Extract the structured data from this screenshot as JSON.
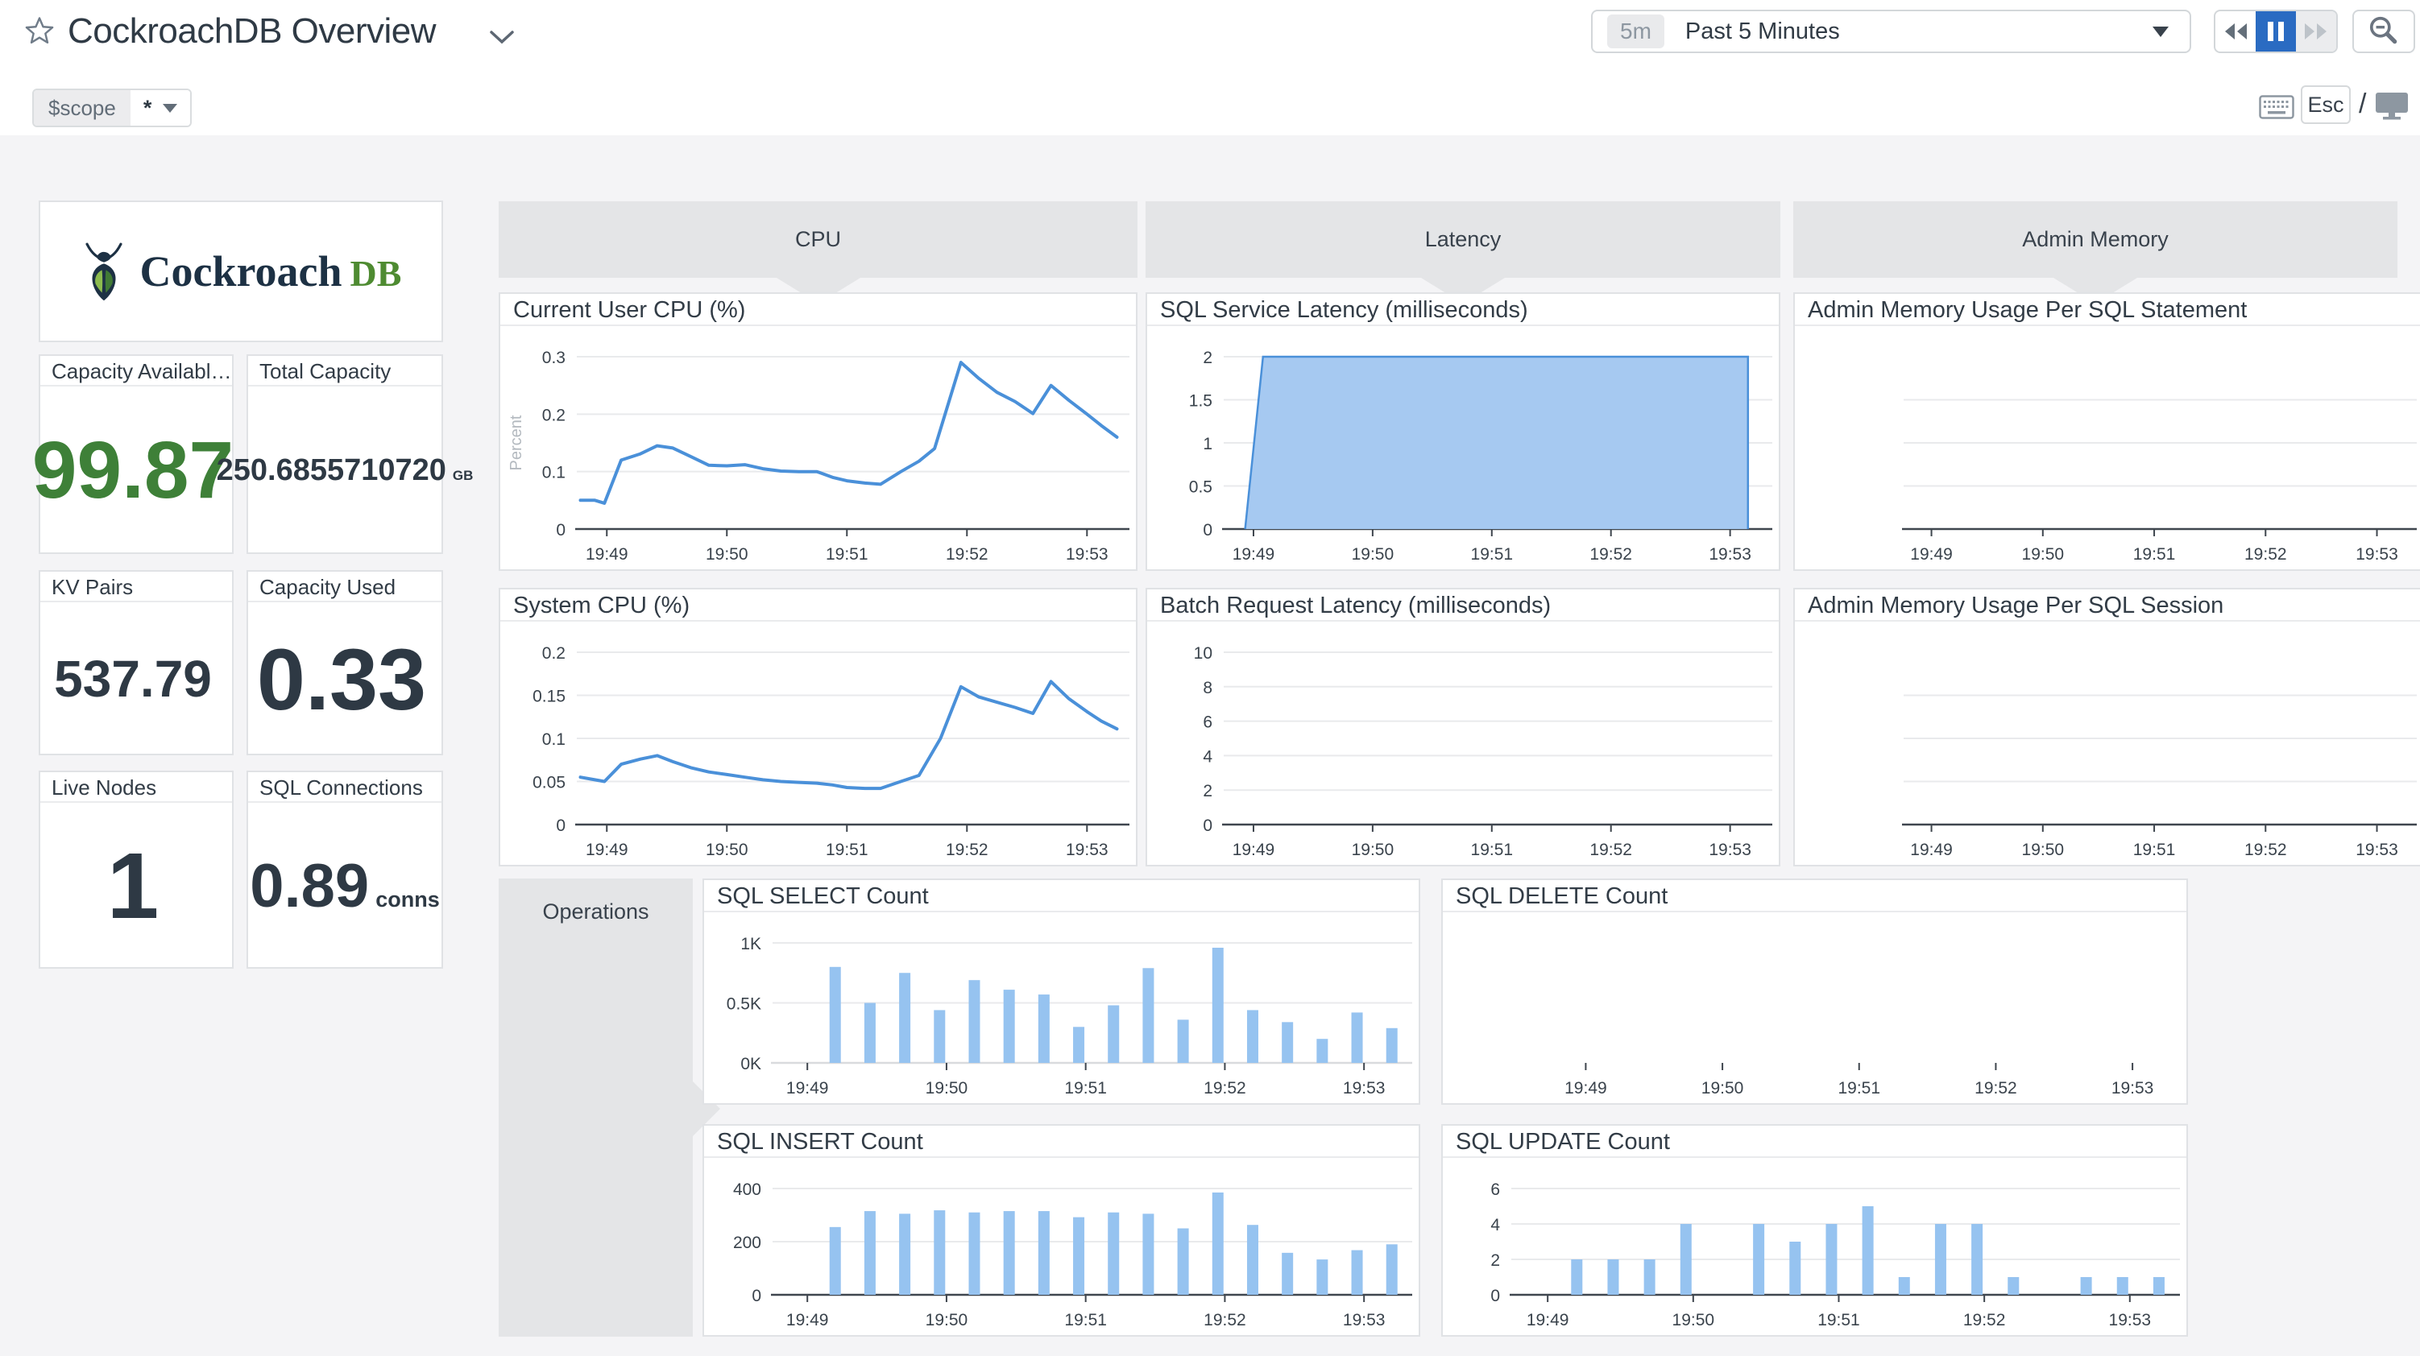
{
  "header": {
    "title": "CockroachDB Overview",
    "time_badge": "5m",
    "time_label": "Past 5 Minutes",
    "esc": "Esc",
    "slash": "/"
  },
  "scope": {
    "label": "$scope",
    "value": "*"
  },
  "logo": {
    "brand": "Cockroach",
    "brand_suffix": "DB"
  },
  "groups": {
    "cpu": "CPU",
    "latency": "Latency",
    "admin_memory": "Admin Memory",
    "operations": "Operations"
  },
  "stats": [
    {
      "label": "Capacity Available...",
      "value": "99.87",
      "unit": "",
      "color": "#3e8038"
    },
    {
      "label": "Total Capacity",
      "value": "250.6855710720",
      "unit": "GB",
      "color": "#2e3944"
    },
    {
      "label": "KV Pairs",
      "value": "537.79",
      "unit": "",
      "color": "#2e3944"
    },
    {
      "label": "Capacity Used",
      "value": "0.33",
      "unit": "",
      "color": "#2e3944"
    },
    {
      "label": "Live Nodes",
      "value": "1",
      "unit": "",
      "color": "#2e3944"
    },
    {
      "label": "SQL Connections",
      "value": "0.89",
      "unit": "conns",
      "color": "#2e3944"
    }
  ],
  "chart_x": {
    "domain": [
      48.75,
      53.3
    ],
    "tick_minutes": [
      49,
      50,
      51,
      52,
      53
    ],
    "tick_labels": [
      "19:49",
      "19:50",
      "19:51",
      "19:52",
      "19:53"
    ]
  },
  "chart_data": [
    {
      "id": "user_cpu",
      "type": "line",
      "title": "Current User CPU (%)",
      "ylabel": "Percent",
      "yticks": [
        0,
        0.1,
        0.2,
        0.3
      ],
      "ytick_labels": [
        "0",
        "0.1",
        "0.2",
        "0.3"
      ],
      "ymax": 0.3,
      "line_color": "#4a90d9",
      "grid": true,
      "legend": "none",
      "points": [
        [
          48.78,
          0.05
        ],
        [
          48.9,
          0.05
        ],
        [
          48.98,
          0.045
        ],
        [
          49.12,
          0.12
        ],
        [
          49.28,
          0.131
        ],
        [
          49.42,
          0.145
        ],
        [
          49.55,
          0.141
        ],
        [
          49.7,
          0.126
        ],
        [
          49.85,
          0.111
        ],
        [
          50.0,
          0.11
        ],
        [
          50.15,
          0.112
        ],
        [
          50.3,
          0.105
        ],
        [
          50.45,
          0.101
        ],
        [
          50.6,
          0.1
        ],
        [
          50.75,
          0.1
        ],
        [
          50.88,
          0.09
        ],
        [
          51.0,
          0.084
        ],
        [
          51.15,
          0.08
        ],
        [
          51.28,
          0.078
        ],
        [
          51.45,
          0.1
        ],
        [
          51.6,
          0.118
        ],
        [
          51.73,
          0.14
        ],
        [
          51.95,
          0.29
        ],
        [
          52.1,
          0.262
        ],
        [
          52.25,
          0.238
        ],
        [
          52.4,
          0.222
        ],
        [
          52.55,
          0.201
        ],
        [
          52.7,
          0.25
        ],
        [
          52.85,
          0.224
        ],
        [
          53.0,
          0.2
        ],
        [
          53.12,
          0.18
        ],
        [
          53.25,
          0.16
        ]
      ]
    },
    {
      "id": "system_cpu",
      "type": "line",
      "title": "System CPU (%)",
      "yticks": [
        0,
        0.05,
        0.1,
        0.15,
        0.2
      ],
      "ytick_labels": [
        "0",
        "0.05",
        "0.1",
        "0.15",
        "0.2"
      ],
      "ymax": 0.2,
      "line_color": "#4a90d9",
      "grid": true,
      "legend": "none",
      "points": [
        [
          48.78,
          0.055
        ],
        [
          48.9,
          0.052
        ],
        [
          48.98,
          0.05
        ],
        [
          49.12,
          0.07
        ],
        [
          49.28,
          0.076
        ],
        [
          49.42,
          0.08
        ],
        [
          49.55,
          0.073
        ],
        [
          49.7,
          0.066
        ],
        [
          49.85,
          0.061
        ],
        [
          50.0,
          0.058
        ],
        [
          50.15,
          0.055
        ],
        [
          50.3,
          0.052
        ],
        [
          50.45,
          0.05
        ],
        [
          50.6,
          0.049
        ],
        [
          50.75,
          0.048
        ],
        [
          50.88,
          0.046
        ],
        [
          51.0,
          0.043
        ],
        [
          51.15,
          0.042
        ],
        [
          51.28,
          0.042
        ],
        [
          51.45,
          0.05
        ],
        [
          51.6,
          0.057
        ],
        [
          51.78,
          0.1
        ],
        [
          51.95,
          0.16
        ],
        [
          52.1,
          0.148
        ],
        [
          52.25,
          0.142
        ],
        [
          52.4,
          0.136
        ],
        [
          52.55,
          0.129
        ],
        [
          52.7,
          0.166
        ],
        [
          52.85,
          0.146
        ],
        [
          53.0,
          0.131
        ],
        [
          53.12,
          0.12
        ],
        [
          53.25,
          0.111
        ]
      ]
    },
    {
      "id": "sql_service_latency",
      "type": "area",
      "title": "SQL Service Latency (milliseconds)",
      "yticks": [
        0,
        0.5,
        1,
        1.5,
        2
      ],
      "ytick_labels": [
        "0",
        "0.5",
        "1",
        "1.5",
        "2"
      ],
      "ymax": 2,
      "fill_color": "#a6c9f1",
      "line_color": "#4a90d9",
      "grid": true,
      "legend": "none",
      "points": [
        [
          48.93,
          0
        ],
        [
          49.08,
          2
        ],
        [
          53.15,
          2
        ],
        [
          53.15,
          0
        ]
      ]
    },
    {
      "id": "batch_request_latency",
      "type": "empty",
      "title": "Batch Request Latency (milliseconds)",
      "yticks": [
        0,
        2,
        4,
        6,
        8,
        10
      ],
      "ytick_labels": [
        "0",
        "2",
        "4",
        "6",
        "8",
        "10"
      ],
      "ymax": 10,
      "grid": true
    },
    {
      "id": "admin_mem_statement",
      "type": "empty",
      "title": "Admin Memory Usage Per SQL Statement",
      "yticks": [],
      "ytick_labels": [],
      "gridlines": 3
    },
    {
      "id": "admin_mem_session",
      "type": "empty",
      "title": "Admin Memory Usage Per SQL Session",
      "yticks": [],
      "ytick_labels": [],
      "gridlines": 3
    },
    {
      "id": "sql_select",
      "type": "bar",
      "title": "SQL SELECT Count",
      "yticks": [
        0,
        500,
        1000
      ],
      "ytick_labels": [
        "0K",
        "0.5K",
        "1K"
      ],
      "ymax": 1000,
      "axis": "light",
      "bar_color": "#96c3f0",
      "bar_start": 49.2,
      "bar_step": 0.25,
      "values": [
        800,
        500,
        750,
        440,
        690,
        610,
        570,
        300,
        480,
        790,
        360,
        960,
        440,
        340,
        200,
        420,
        290
      ]
    },
    {
      "id": "sql_delete",
      "type": "empty",
      "title": "SQL DELETE Count",
      "yticks": [],
      "ytick_labels": [],
      "axis": "none"
    },
    {
      "id": "sql_insert",
      "type": "bar",
      "title": "SQL INSERT Count",
      "yticks": [
        0,
        200,
        400
      ],
      "ytick_labels": [
        "0",
        "200",
        "400"
      ],
      "ymax": 400,
      "bar_color": "#96c3f0",
      "bar_start": 49.2,
      "bar_step": 0.25,
      "values": [
        255,
        315,
        305,
        318,
        310,
        315,
        315,
        292,
        310,
        305,
        250,
        385,
        263,
        158,
        133,
        168,
        190
      ]
    },
    {
      "id": "sql_update",
      "type": "bar",
      "title": "SQL UPDATE Count",
      "yticks": [
        0,
        2,
        4,
        6
      ],
      "ytick_labels": [
        "0",
        "2",
        "4",
        "6"
      ],
      "ymax": 6,
      "bar_color": "#96c3f0",
      "bar_start": 49.2,
      "bar_step": 0.25,
      "values": [
        2,
        2,
        2,
        4,
        0,
        4,
        3,
        4,
        5,
        1,
        4,
        4,
        1,
        0,
        1,
        1,
        1
      ]
    }
  ]
}
